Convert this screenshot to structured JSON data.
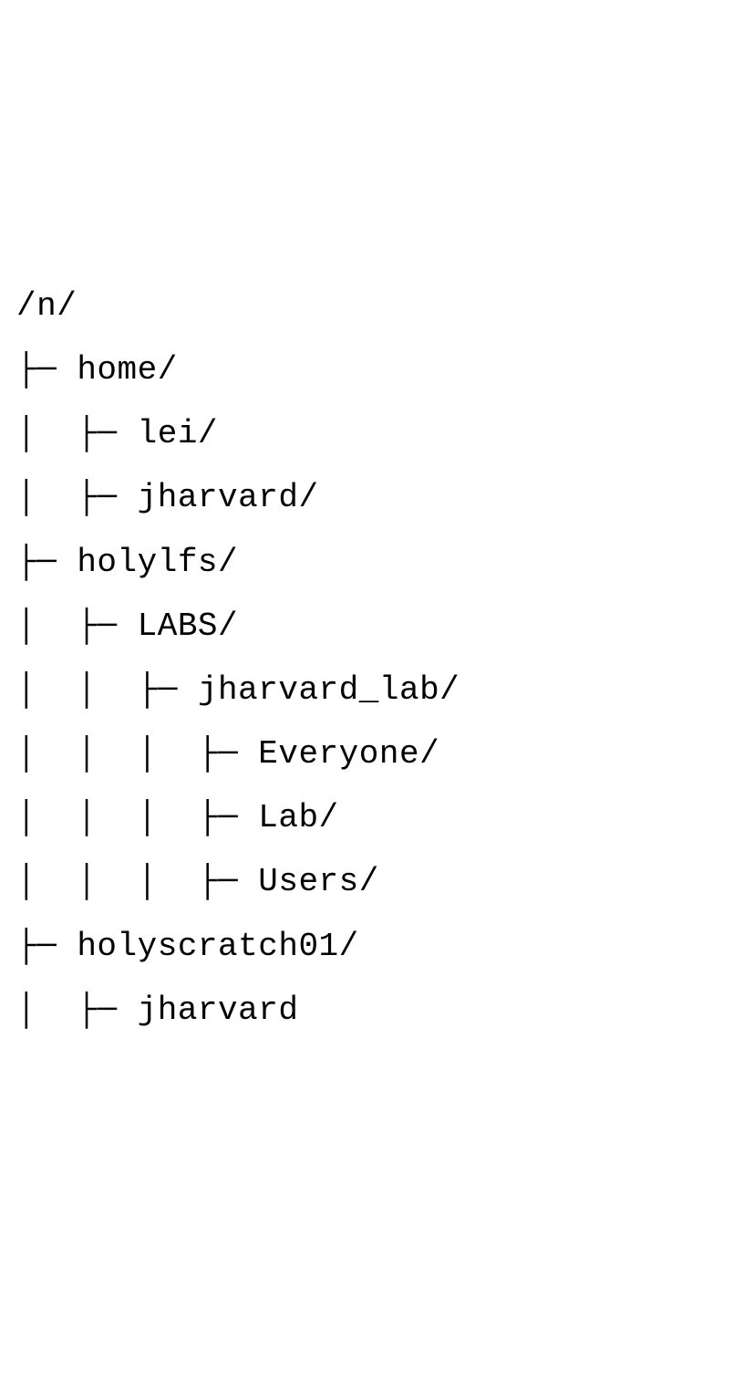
{
  "tree": {
    "root": "/n/",
    "lines": [
      {
        "prefix": "├─ ",
        "name": "home/"
      },
      {
        "prefix": "│  ├─ ",
        "name": "lei/"
      },
      {
        "prefix": "│  ├─ ",
        "name": "jharvard/"
      },
      {
        "prefix": "├─ ",
        "name": "holylfs/"
      },
      {
        "prefix": "│  ├─ ",
        "name": "LABS/"
      },
      {
        "prefix": "│  │  ├─ ",
        "name": "jharvard_lab/"
      },
      {
        "prefix": "│  │  │  ├─ ",
        "name": "Everyone/"
      },
      {
        "prefix": "│  │  │  ├─ ",
        "name": "Lab/"
      },
      {
        "prefix": "│  │  │  ├─ ",
        "name": "Users/"
      },
      {
        "prefix": "├─ ",
        "name": "holyscratch01/"
      },
      {
        "prefix": "│  ├─ ",
        "name": "jharvard"
      }
    ]
  }
}
